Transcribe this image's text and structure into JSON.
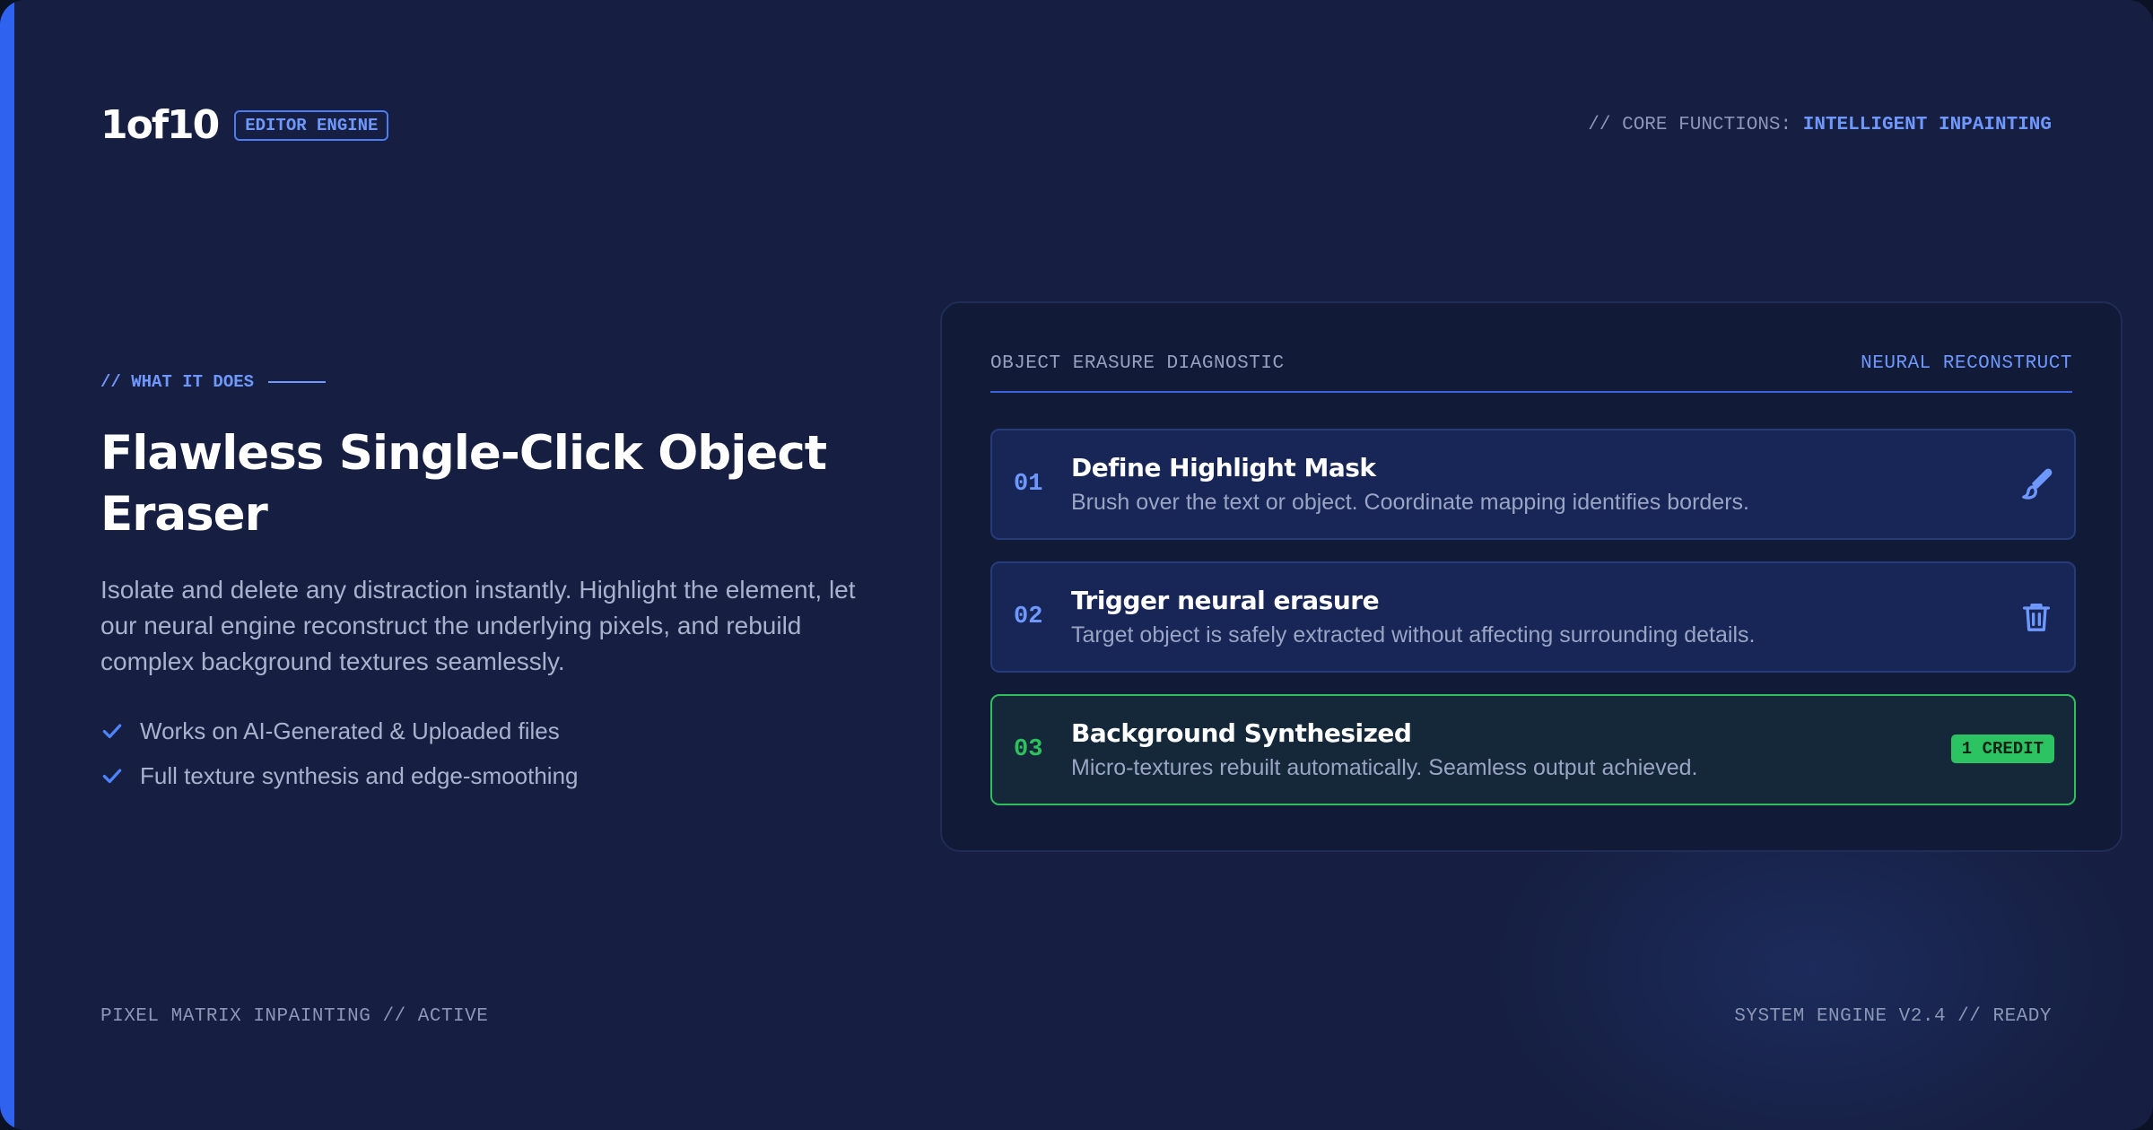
{
  "brand": {
    "logo": "1of10",
    "badge": "EDITOR ENGINE"
  },
  "header": {
    "core_prefix": "// CORE FUNCTIONS:",
    "core_value": "INTELLIGENT INPAINTING"
  },
  "intro": {
    "eyebrow": "// WHAT IT DOES",
    "headline": "Flawless Single-Click Object Eraser",
    "description": "Isolate and delete any distraction instantly. Highlight the element, let our neural engine reconstruct the underlying pixels, and rebuild complex background textures seamlessly.",
    "features": [
      {
        "label": "Works on AI-Generated & Uploaded files",
        "icon": "check-icon"
      },
      {
        "label": "Full texture synthesis and edge-smoothing",
        "icon": "check-icon"
      }
    ]
  },
  "panel": {
    "title": "OBJECT ERASURE DIAGNOSTIC",
    "tag": "NEURAL RECONSTRUCT",
    "steps": [
      {
        "number": "01",
        "title": "Define Highlight Mask",
        "description": "Brush over the text or object. Coordinate mapping identifies borders.",
        "icon": "brush-icon",
        "state": "active"
      },
      {
        "number": "02",
        "title": "Trigger neural erasure",
        "description": "Target object is safely extracted without affecting surrounding details.",
        "icon": "trash-icon",
        "state": "active"
      },
      {
        "number": "03",
        "title": "Background Synthesized",
        "description": "Micro-textures rebuilt automatically. Seamless output achieved.",
        "badge": "1 CREDIT",
        "state": "complete"
      }
    ]
  },
  "footer": {
    "left": "PIXEL MATRIX INPAINTING // ACTIVE",
    "right": "SYSTEM ENGINE V2.4 // READY"
  },
  "colors": {
    "background": "#161f41",
    "accent": "#2f62ee",
    "link": "#6f98ff",
    "success": "#2fc05e",
    "panel": "#111a36"
  }
}
